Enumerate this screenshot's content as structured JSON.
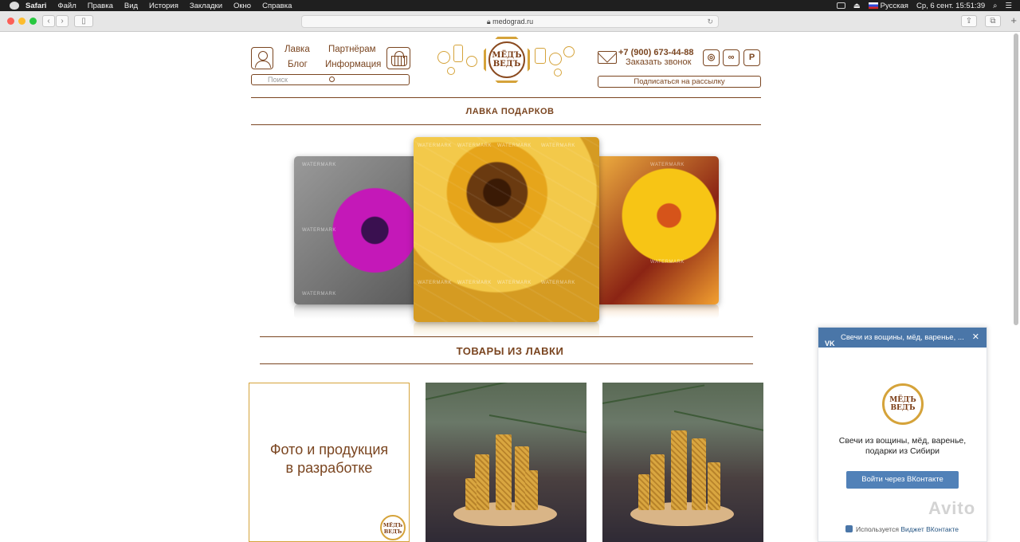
{
  "menubar": {
    "app": "Safari",
    "items": [
      "Файл",
      "Правка",
      "Вид",
      "История",
      "Закладки",
      "Окно",
      "Справка"
    ],
    "input_source": "Русская",
    "datetime": "Ср, 6 сент.  15:51:39"
  },
  "browser": {
    "url": "medograd.ru"
  },
  "header": {
    "nav": {
      "shop": "Лавка",
      "partners": "Партнёрам",
      "blog": "Блог",
      "info": "Информация"
    },
    "search_placeholder": "Поиск",
    "logo_top": "МЁДЪ",
    "logo_bottom": "ВЕДЪ",
    "phone": "+7 (900) 673-44-88",
    "callback": "Заказать звонок",
    "subscribe": "Подписаться на рассылку"
  },
  "sections": {
    "gift_shop": "ЛАВКА ПОДАРКОВ",
    "goods": "ТОВАРЫ ИЗ ЛАВКИ"
  },
  "carousel": {
    "watermark": "WATERMARK"
  },
  "products": {
    "placeholder_line1": "Фото и продукция",
    "placeholder_line2": "в разработке"
  },
  "vk_widget": {
    "header": "Свечи из вощины, мёд, варенье, ...",
    "title_line1": "Свечи из вощины, мёд, варенье,",
    "title_line2": "подарки из Сибири",
    "button": "Войти через ВКонтакте",
    "footer_prefix": "Используется",
    "footer_link": "Виджет ВКонтакте"
  },
  "watermark_overlay": "Avito",
  "colors": {
    "brand_brown": "#7a4520",
    "brand_gold": "#d5a33a",
    "vk_blue": "#4a76a8"
  }
}
